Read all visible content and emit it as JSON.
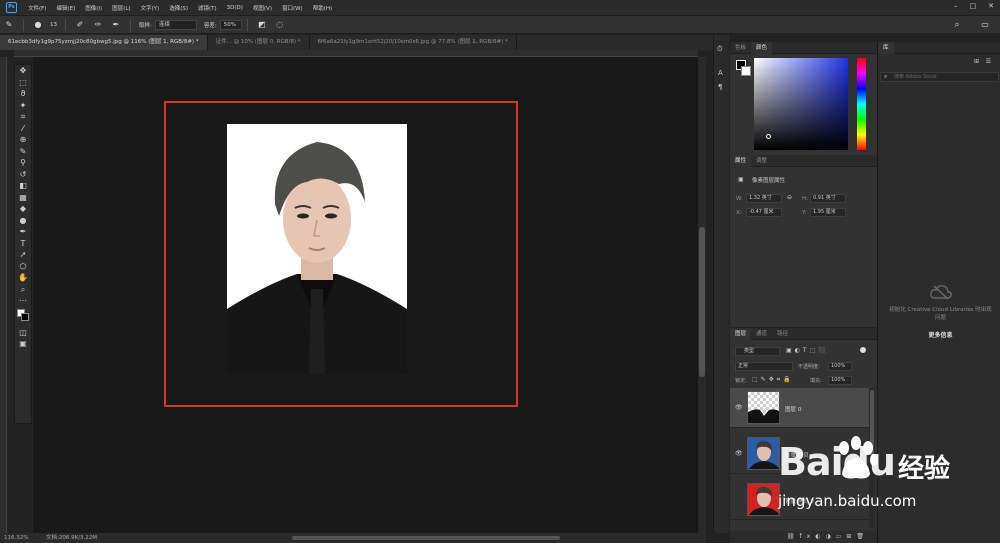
{
  "menubar": {
    "logo": "Ps",
    "items": [
      "文件(F)",
      "编辑(E)",
      "图像(I)",
      "图层(L)",
      "文字(Y)",
      "选择(S)",
      "滤镜(T)",
      "3D(D)",
      "视图(V)",
      "窗口(W)",
      "帮助(H)"
    ]
  },
  "options": {
    "size_value": "13",
    "contiguous_label": "取样:",
    "sample_value": "连续",
    "tolerance_label": "容差:",
    "tolerance_value": "50%"
  },
  "tabs": [
    {
      "label": "61ecbb3dfy1g9p75yzmjj20c80gbwg5.jpg @ 116% (图层 1, RGB/8#) *",
      "active": true
    },
    {
      "label": "证件... @ 10% (图层 0, RGB/8) *",
      "active": false
    },
    {
      "label": "6f6a6a21ly1g9m1xrh52j20j10sm0s6.jpg @ 77.8% (图层 1, RGB/8#) *",
      "active": false
    }
  ],
  "status": {
    "zoom": "116.32%",
    "doc": "文档:206.9K/3.22M"
  },
  "color_panel": {
    "tabs": [
      "色板",
      "颜色"
    ],
    "active_tab": 1
  },
  "properties": {
    "tabs": [
      "属性",
      "调整"
    ],
    "section": "像素图层属性",
    "w_label": "W:",
    "w_value": "1.32 英寸",
    "h_label": "H:",
    "h_value": "0.91 英寸",
    "x_label": "X:",
    "x_value": "-0.47 厘米",
    "y_label": "Y:",
    "y_value": "1.95 厘米"
  },
  "layers_panel": {
    "tabs": [
      "图层",
      "通道",
      "路径"
    ],
    "filter": "类型",
    "blend_mode": "正常",
    "opacity_label": "不透明度:",
    "opacity_value": "100%",
    "lock_label": "锁定:",
    "fill_label": "填充:",
    "fill_value": "100%",
    "layers": [
      {
        "name": "图层 0",
        "thumb": "transparent"
      },
      {
        "name": "背景 拷贝",
        "thumb": "blue"
      },
      {
        "name": "背景 拷贝 2",
        "thumb": "red"
      }
    ]
  },
  "libraries": {
    "tab": "库",
    "search_placeholder": "搜索 Adobe Stock",
    "message": "初始化 Creative Cloud Libraries 时出现问题",
    "more_info": "更多信息"
  },
  "watermark": {
    "brand": "Baidu",
    "sub": "经验",
    "url": "jingyan.baidu.com"
  },
  "colors": {
    "accent": "#3da8f5",
    "frame": "#d0392b"
  }
}
